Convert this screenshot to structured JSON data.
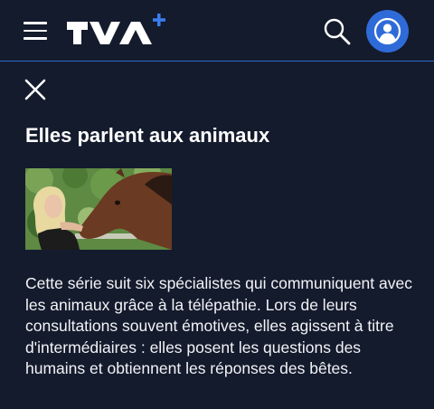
{
  "header": {
    "menu_icon": "hamburger-menu-icon",
    "logo_text": "TVA+",
    "search_icon": "search-icon",
    "account_icon": "user-account-icon"
  },
  "detail": {
    "close_icon": "close-icon",
    "title": "Elles parlent aux animaux",
    "thumbnail_alt": "Une femme blonde caresse la tête d'un cheval brun",
    "description": "Cette série suit six spécialistes qui communiquent avec les animaux grâce à la télépathie. Lors de leurs consultations souvent émotives, elles agissent à titre d'intermédiaires : elles posent les questions des humains et obtiennent les réponses des bêtes."
  },
  "colors": {
    "background": "#141b2d",
    "accent": "#2f6bd8",
    "divider": "#2f67c9",
    "text": "#ffffff"
  }
}
